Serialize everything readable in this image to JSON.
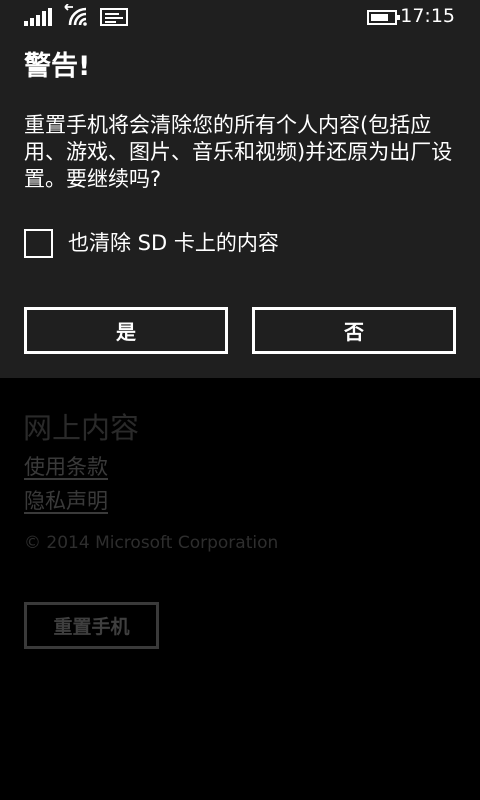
{
  "status_bar": {
    "time": "17:15",
    "icons": [
      "signal-strength-icon",
      "wifi-icon",
      "message-icon",
      "battery-icon"
    ]
  },
  "dialog": {
    "title": "警告!",
    "message": "重置手机将会清除您的所有个人内容(包括应用、游戏、图片、音乐和视频)并还原为出厂设置。要继续吗?",
    "checkbox": {
      "label": "也清除 SD 卡上的内容",
      "checked": false
    },
    "buttons": {
      "yes": "是",
      "no": "否"
    }
  },
  "background_page": {
    "section_title": "网上内容",
    "links": [
      "使用条款",
      "隐私声明"
    ],
    "copyright": "© 2014 Microsoft Corporation",
    "reset_button": "重置手机"
  },
  "colors": {
    "dialog_background": "#1f1f1f",
    "page_background": "#000000",
    "foreground": "#ffffff",
    "dimmed_text": "#3a3a3a"
  }
}
